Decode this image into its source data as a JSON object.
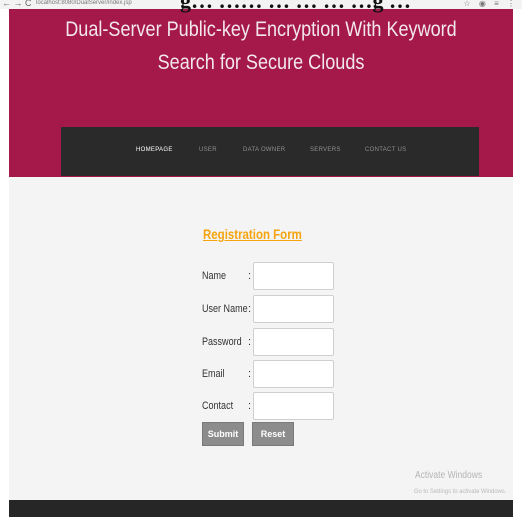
{
  "caption": "g… …… … … … …g …",
  "browser": {
    "nav_glyphs": "← → C",
    "url": "localhost:8080/DualServer/index.jsp",
    "right_icons": "☆ ◉ ≡ ⋮"
  },
  "header": {
    "title_line1": "Dual-Server Public-key Encryption With Keyword",
    "title_line2": "Search for Secure Clouds"
  },
  "nav": {
    "items": [
      {
        "label": "HOMEPAGE",
        "active": true
      },
      {
        "label": "USER",
        "active": false
      },
      {
        "label": "DATA OWNER",
        "active": false
      },
      {
        "label": "SERVERS",
        "active": false
      },
      {
        "label": "CONTACT US",
        "active": false
      }
    ]
  },
  "form": {
    "title": "Registration Form",
    "separator": ":",
    "fields": [
      {
        "label": "Name",
        "value": ""
      },
      {
        "label": "User Name",
        "value": ""
      },
      {
        "label": "Password",
        "value": ""
      },
      {
        "label": "Email",
        "value": ""
      },
      {
        "label": "Contact",
        "value": ""
      }
    ],
    "submit_label": "Submit",
    "reset_label": "Reset"
  },
  "watermark": {
    "title": "Activate Windows",
    "subtitle": "Go to Settings to activate Windows."
  }
}
